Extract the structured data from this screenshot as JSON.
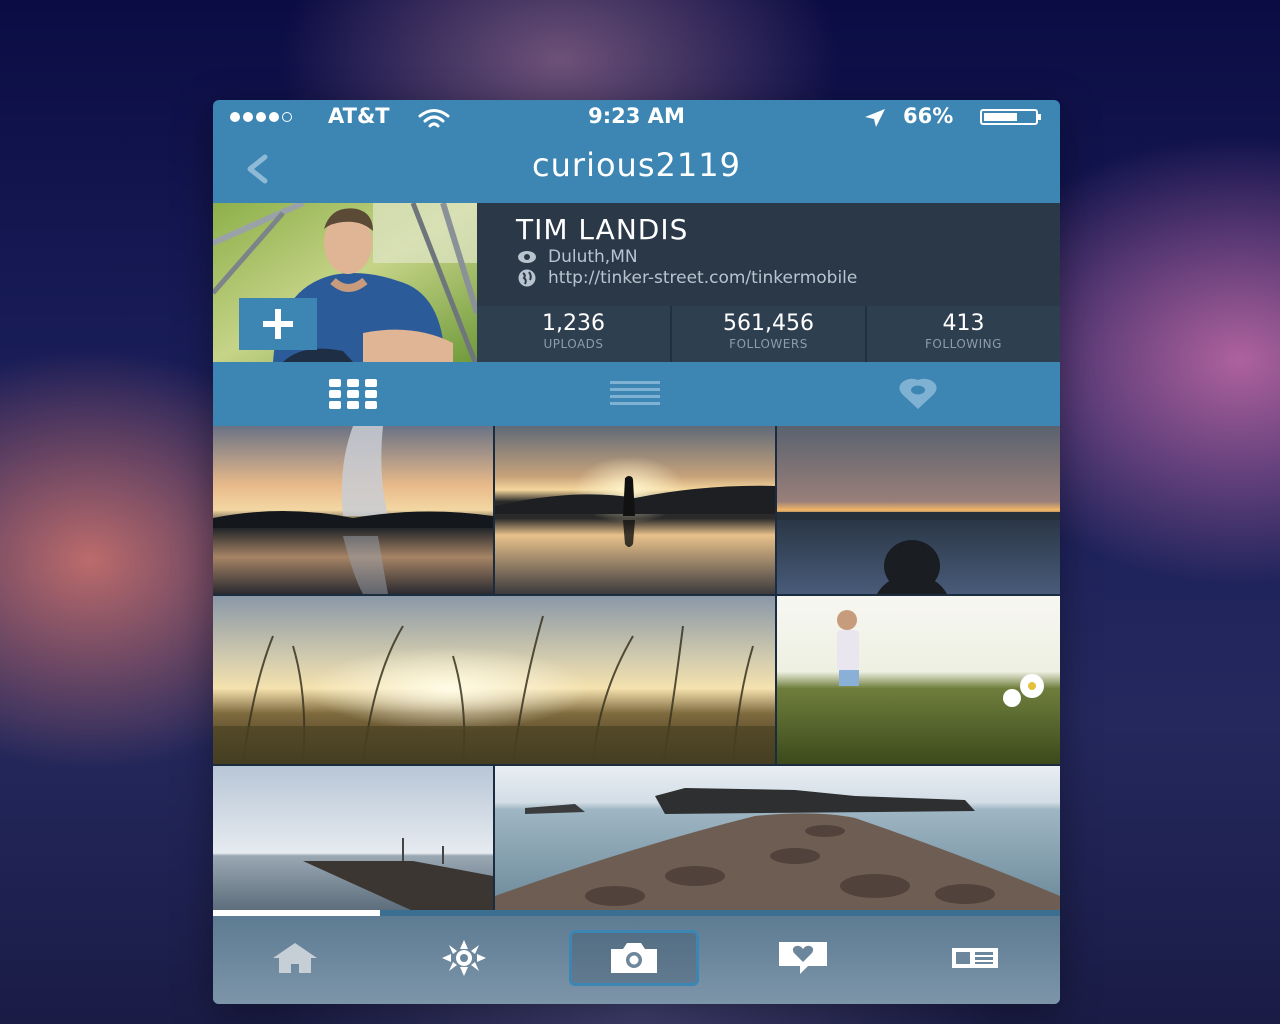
{
  "status_bar": {
    "carrier": "AT&T",
    "signal_bars_filled": 4,
    "signal_bars_total": 5,
    "time": "9:23 AM",
    "battery_percent_label": "66%",
    "battery_level": 0.66
  },
  "nav": {
    "back_icon": "chevron-left-icon",
    "username": "curious2119"
  },
  "profile": {
    "name": "TIM LANDIS",
    "location": "Duluth,MN",
    "website": "http://tinker-street.com/tinkermobile",
    "add_icon": "plus-icon",
    "stats": [
      {
        "value": "1,236",
        "label": "UPLOADS"
      },
      {
        "value": "561,456",
        "label": "FOLLOWERS"
      },
      {
        "value": "413",
        "label": "FOLLOWING"
      }
    ]
  },
  "view_tabs": [
    {
      "icon": "grid-icon",
      "active": true
    },
    {
      "icon": "list-icon",
      "active": false
    },
    {
      "icon": "map-pin-icon",
      "active": false
    }
  ],
  "photos": [
    "geyser-sunset-photo",
    "person-sunset-lake-photo",
    "child-lake-sunset-photo",
    "grass-sunset-photo",
    "girl-meadow-photo",
    "pier-calm-water-photo",
    "rocky-breakwater-photo"
  ],
  "tab_bar": [
    {
      "icon": "home-icon",
      "active": false
    },
    {
      "icon": "sun-icon",
      "active": false
    },
    {
      "icon": "camera-icon",
      "active": true
    },
    {
      "icon": "heart-message-icon",
      "active": false
    },
    {
      "icon": "profile-card-icon",
      "active": false
    }
  ],
  "colors": {
    "accent": "#3d86b4",
    "profile_bg": "#2a3848",
    "text_muted": "#b9c4cf"
  }
}
